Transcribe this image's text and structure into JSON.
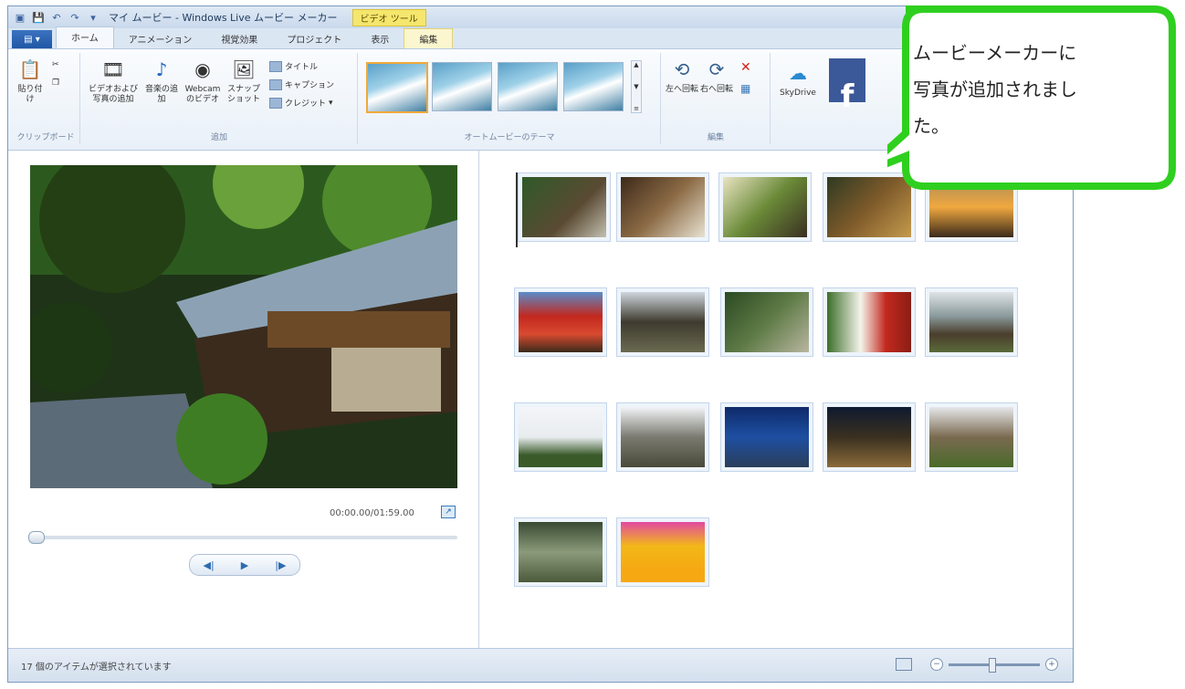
{
  "titlebar": {
    "app_title": "マイ ムービー - Windows Live ムービー メーカー",
    "context_tab_title": "ビデオ ツール"
  },
  "tabs": [
    {
      "label": "ホーム"
    },
    {
      "label": "アニメーション"
    },
    {
      "label": "視覚効果"
    },
    {
      "label": "プロジェクト"
    },
    {
      "label": "表示"
    },
    {
      "label": "編集"
    }
  ],
  "ribbon": {
    "clipboard": {
      "paste_label": "貼り付け",
      "group_label": "クリップボード"
    },
    "add": {
      "add_video_photo_label": "ビデオおよび写真の追加",
      "add_music_label": "音楽の追加",
      "webcam_label": "Webcam のビデオ",
      "snapshot_label": "スナップショット",
      "title_label": "タイトル",
      "caption_label": "キャプション",
      "credit_label": "クレジット",
      "group_label": "追加"
    },
    "theme": {
      "group_label": "オートムービーのテーマ"
    },
    "edit": {
      "rotate_left_label": "左へ回転",
      "rotate_right_label": "右へ回転",
      "group_label": "編集"
    },
    "share": {
      "skydrive_label": "SkyDrive",
      "facebook_label": "f"
    }
  },
  "preview": {
    "timecode": "00:00.00/01:59.00"
  },
  "status": {
    "text": "17 個のアイテムが選択されています"
  },
  "callout": {
    "line1": "ムービーメーカーに",
    "line2": "写真が追加されまし",
    "line3": "た。"
  },
  "colors": {
    "accent_blue": "#1f57a6",
    "callout_green": "#2fcf1f",
    "selection_orange": "#f0a93a"
  }
}
